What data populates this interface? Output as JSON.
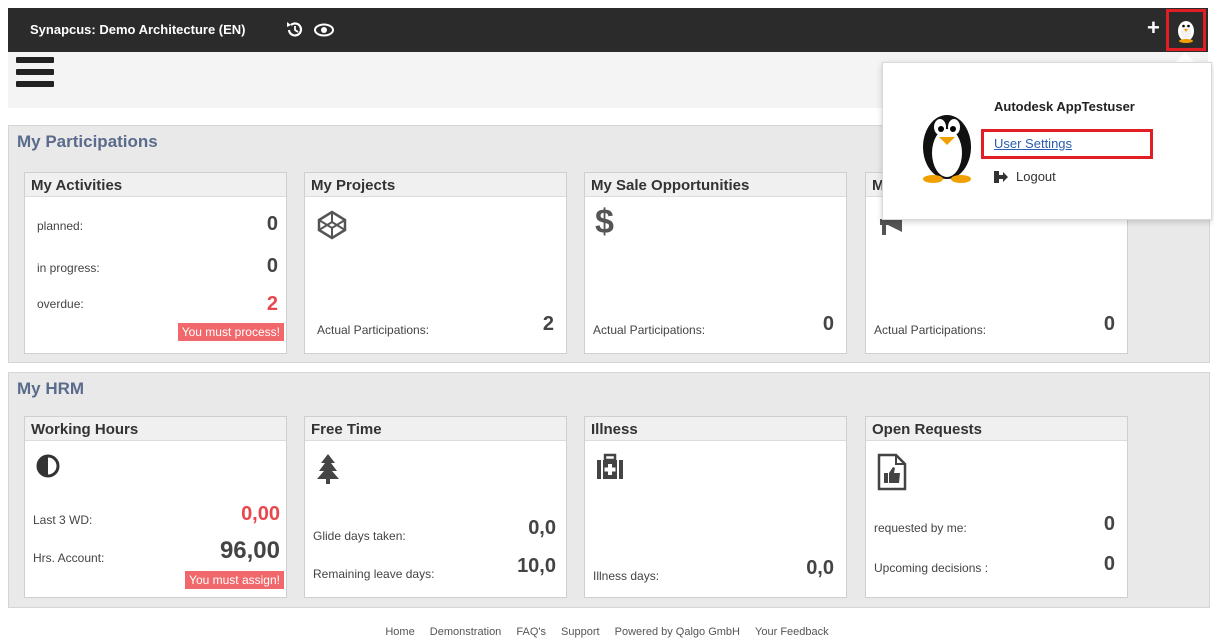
{
  "topbar": {
    "title": "Synapcus: Demo Architecture (EN)",
    "icons": [
      "history-icon",
      "eye-icon",
      "plus-icon",
      "user-avatar-icon"
    ]
  },
  "participations": {
    "title": "My Participations",
    "activities": {
      "title": "My Activities",
      "planned_label": "planned:",
      "planned": "0",
      "progress_label": "in progress:",
      "progress": "0",
      "overdue_label": "overdue:",
      "overdue": "2",
      "warning": "You must process!"
    },
    "projects": {
      "title": "My Projects",
      "label": "Actual Participations:",
      "value": "2"
    },
    "sales": {
      "title": "My Sale Opportunities",
      "label": "Actual Participations:",
      "value": "0"
    },
    "fourth": {
      "title": "M",
      "label": "Actual Participations:",
      "value": "0"
    }
  },
  "hrm": {
    "title": "My HRM",
    "working": {
      "title": "Working Hours",
      "last_label": "Last 3 WD:",
      "last": "0,00",
      "account_label": "Hrs. Account:",
      "account": "96,00",
      "warning": "You must assign!"
    },
    "free": {
      "title": "Free Time",
      "glide_label": "Glide days taken:",
      "glide": "0,0",
      "leave_label": "Remaining leave days:",
      "leave": "10,0"
    },
    "illness": {
      "title": "Illness",
      "label": "Illness days:",
      "value": "0,0"
    },
    "requests": {
      "title": "Open Requests",
      "requested_label": "requested by me:",
      "requested": "0",
      "upcoming_label": "Upcoming decisions :",
      "upcoming": "0"
    }
  },
  "user_menu": {
    "name": "Autodesk AppTestuser",
    "settings": "User Settings",
    "logout": "Logout"
  },
  "footer": {
    "links": [
      "Home",
      "Demonstration",
      "FAQ's",
      "Support",
      "Powered by Qalgo GmbH",
      "Your Feedback"
    ]
  },
  "colors": {
    "topbar": "#2b2b2b",
    "accent_red": "#e8484d",
    "section_title": "#5a6b8c",
    "highlight": "#e01e24"
  }
}
